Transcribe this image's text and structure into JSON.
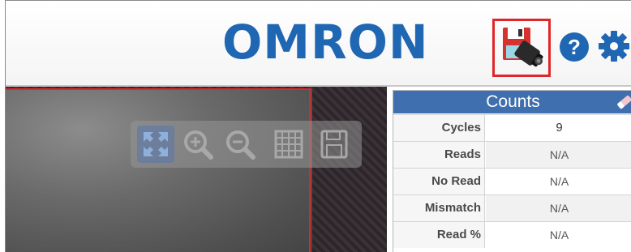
{
  "header": {
    "logo_text": "OMRON",
    "help_symbol": "?",
    "brand_color": "#1f66b3",
    "highlight_color": "#e0262a"
  },
  "icons": {
    "save": "save-to-camera-icon",
    "help": "help-icon",
    "settings": "gear-icon",
    "toolbar": [
      "fit-to-window-icon",
      "zoom-in-icon",
      "zoom-out-icon",
      "grid-icon",
      "save-image-icon"
    ],
    "clear": "eraser-icon"
  },
  "counts": {
    "title": "Counts",
    "rows": [
      {
        "label": "Cycles",
        "value": "9"
      },
      {
        "label": "Reads",
        "value": "N/A"
      },
      {
        "label": "No Read",
        "value": "N/A"
      },
      {
        "label": "Mismatch",
        "value": "N/A"
      },
      {
        "label": "Read %",
        "value": "N/A"
      }
    ]
  }
}
